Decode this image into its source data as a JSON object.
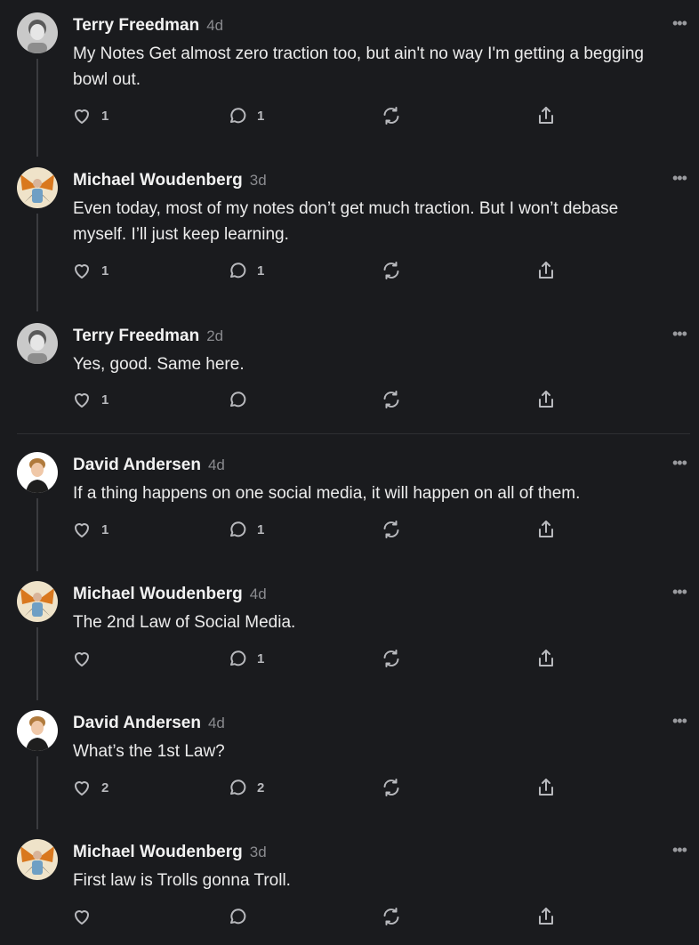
{
  "comments": [
    {
      "author": "Terry Freedman",
      "time": "4d",
      "avatar": "terry-avatar",
      "lines": [
        "My Notes Get almost zero traction too, but ain't no way I'm getting a begging",
        "bowl out."
      ],
      "likes": "1",
      "replies": "1"
    },
    {
      "author": "Michael Woudenberg",
      "time": "3d",
      "avatar": "michael-avatar",
      "lines": [
        "Even today, most of my notes don’t get much traction. But I won’t debase",
        "myself. I’ll just keep learning."
      ],
      "likes": "1",
      "replies": "1"
    },
    {
      "author": "Terry Freedman",
      "time": "2d",
      "avatar": "terry-avatar",
      "lines": [
        "Yes, good. Same here."
      ],
      "likes": "1",
      "replies": ""
    },
    {
      "author": "David Andersen",
      "time": "4d",
      "avatar": "david-avatar",
      "lines": [
        "If a thing happens on one social media, it will happen on all of them."
      ],
      "likes": "1",
      "replies": "1"
    },
    {
      "author": "Michael Woudenberg",
      "time": "4d",
      "avatar": "michael-avatar",
      "lines": [
        "The 2nd Law of Social Media."
      ],
      "likes": "",
      "replies": "1"
    },
    {
      "author": "David Andersen",
      "time": "4d",
      "avatar": "david-avatar",
      "lines": [
        "What’s the 1st Law?"
      ],
      "likes": "2",
      "replies": "2"
    },
    {
      "author": "Michael Woudenberg",
      "time": "3d",
      "avatar": "michael-avatar",
      "lines": [
        "First law is Trolls gonna Troll."
      ],
      "likes": "",
      "replies": ""
    }
  ],
  "more_label": "•••",
  "colors": {
    "background": "#1a1b1e",
    "text": "#ececec",
    "muted": "#8a8b8f",
    "icon": "#b8b9bd"
  }
}
